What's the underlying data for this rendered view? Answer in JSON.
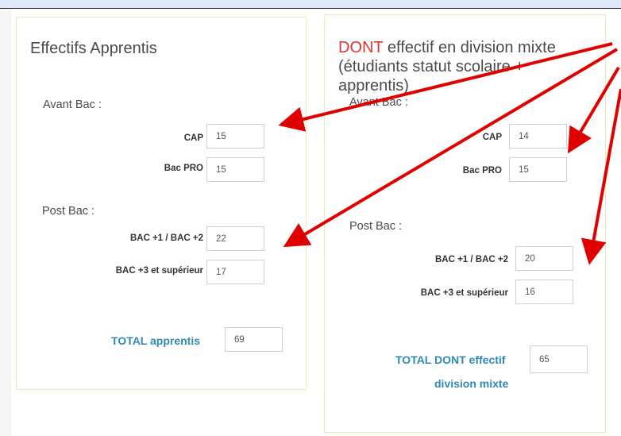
{
  "left_panel": {
    "title": "Effectifs Apprentis",
    "avant_bac_label": "Avant Bac :",
    "post_bac_label": "Post Bac :",
    "rows": [
      {
        "label": "CAP",
        "value": "15"
      },
      {
        "label": "Bac PRO",
        "value": "15"
      },
      {
        "label": "BAC +1 / BAC +2",
        "value": "22"
      },
      {
        "label": "BAC +3 et supérieur",
        "value": "17"
      }
    ],
    "total_label": "TOTAL apprentis",
    "total_value": "69"
  },
  "right_panel": {
    "title_highlight": "DONT",
    "title_rest": " effectif en division mixte (étudiants statut scolaire + apprentis)",
    "avant_bac_label": "Avant Bac :",
    "post_bac_label": "Post Bac :",
    "rows": [
      {
        "label": "CAP",
        "value": "14"
      },
      {
        "label": "Bac PRO",
        "value": "15"
      },
      {
        "label": "BAC +1 / BAC +2",
        "value": "20"
      },
      {
        "label": "BAC +3 et supérieur",
        "value": "16"
      }
    ],
    "total_label_line1": "TOTAL DONT effectif",
    "total_label_line2": "division mixte",
    "total_value": "65"
  },
  "colors": {
    "annotation_arrow": "#e00000",
    "total_label": "#2f8ab6",
    "highlight": "#e03232",
    "panel_border": "#f1e8b6"
  }
}
